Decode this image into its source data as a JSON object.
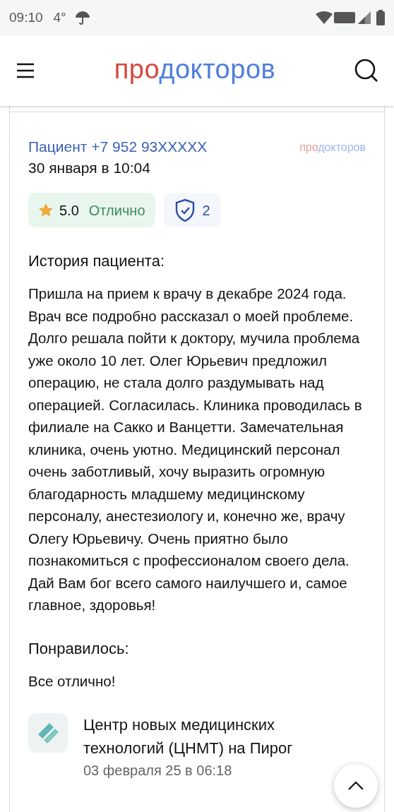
{
  "status_bar": {
    "time": "09:10",
    "temperature": "4°"
  },
  "header": {
    "logo_first": "про",
    "logo_second": "докторов"
  },
  "review": {
    "author": "Пациент +7 952 93XXXXX",
    "source_logo_first": "про",
    "source_logo_second": "докторов",
    "date": "30 января в 10:04",
    "rating": {
      "score": "5.0",
      "label": "Отлично"
    },
    "verified_count": "2",
    "sections": [
      {
        "heading": "История пациента:",
        "text": "Пришла на прием к врачу в декабре 2024 года. Врач все подробно рассказал о моей проблеме. Долго решала пойти к доктору, мучила проблема уже около 10 лет. Олег Юрьевич предложил операцию, не стала долго раздумывать над операцией. Согласилась. Клиника проводилась в филиале на Сакко и Ванцетти. Замечательная клиника, очень уютно. Медицинский персонал очень заботливый, хочу выразить огромную благодарность младшему медицинскому персоналу, анестезиологу и, конечно же, врачу Олегу Юрьевичу. Очень приятно было познакомиться с профессионалом своего дела. Дай Вам бог всего самого наилучшего и, самое главное, здоровья!"
      },
      {
        "heading": "Понравилось:",
        "text": "Все отлично!"
      }
    ],
    "reply": {
      "clinic": "Центр новых медицинских технологий (ЦНМТ) на Пирог",
      "date": "03 февраля 25 в 06:18"
    }
  }
}
